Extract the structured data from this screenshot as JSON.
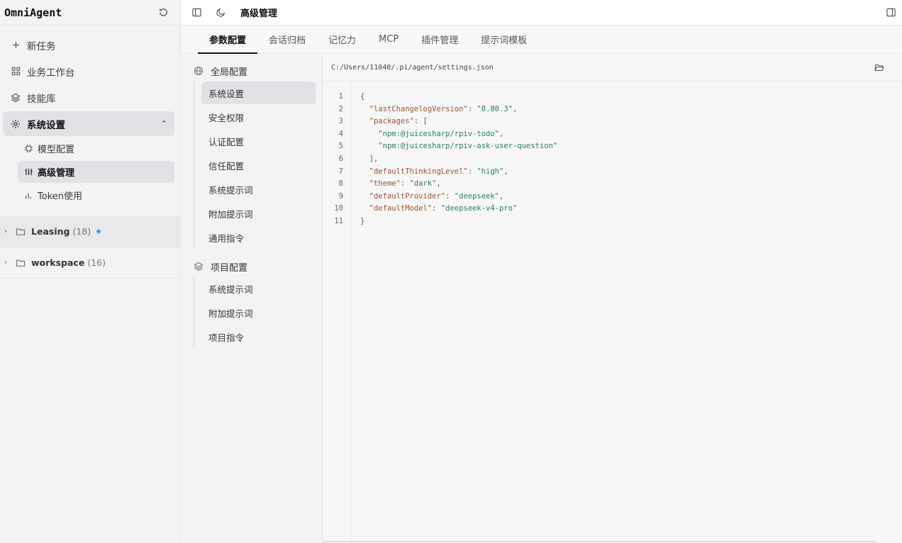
{
  "app": {
    "title": "OmniAgent"
  },
  "sidebar": {
    "items": [
      {
        "label": "新任务",
        "icon": "plus-icon"
      },
      {
        "label": "业务工作台",
        "icon": "grid-icon"
      },
      {
        "label": "技能库",
        "icon": "layers-icon"
      },
      {
        "label": "系统设置",
        "icon": "gear-icon"
      }
    ],
    "sub_items": [
      {
        "label": "模型配置",
        "icon": "chip-icon"
      },
      {
        "label": "高级管理",
        "icon": "sliders-icon"
      },
      {
        "label": "Token使用",
        "icon": "bar-chart-icon"
      }
    ],
    "folders": [
      {
        "name": "Leasing",
        "count": "(18)",
        "star": "★"
      },
      {
        "name": "workspace",
        "count": "(16)"
      }
    ]
  },
  "topbar": {
    "title": "高级管理"
  },
  "tabs": [
    {
      "label": "参数配置"
    },
    {
      "label": "会话归档"
    },
    {
      "label": "记忆力"
    },
    {
      "label": "MCP"
    },
    {
      "label": "插件管理"
    },
    {
      "label": "提示词模板"
    }
  ],
  "config_tree": {
    "global": {
      "label": "全局配置",
      "items": [
        "系统设置",
        "安全权限",
        "认证配置",
        "信任配置",
        "系统提示词",
        "附加提示词",
        "通用指令"
      ]
    },
    "project": {
      "label": "项目配置",
      "items": [
        "系统提示词",
        "附加提示词",
        "项目指令"
      ]
    }
  },
  "editor": {
    "file_path": "C:/Users/11040/.pi/agent/settings.json",
    "line_numbers": [
      "1",
      "2",
      "3",
      "4",
      "5",
      "6",
      "7",
      "8",
      "9",
      "10",
      "11"
    ],
    "lines": [
      {
        "indent": "",
        "key": "",
        "value": "",
        "punct": "{"
      },
      {
        "indent": "  ",
        "key": "\"lastChangelogVersion\"",
        "sep": ": ",
        "value": "\"0.80.3\"",
        "punct": ","
      },
      {
        "indent": "  ",
        "key": "\"packages\"",
        "sep": ": ",
        "value": "",
        "punct": "["
      },
      {
        "indent": "    ",
        "key": "",
        "value": "\"npm:@juicesharp/rpiv-todo\"",
        "punct": ","
      },
      {
        "indent": "    ",
        "key": "",
        "value": "\"npm:@juicesharp/rpiv-ask-user-question\"",
        "punct": ""
      },
      {
        "indent": "  ",
        "key": "",
        "value": "",
        "punct": "],"
      },
      {
        "indent": "  ",
        "key": "\"defaultThinkingLevel\"",
        "sep": ": ",
        "value": "\"high\"",
        "punct": ","
      },
      {
        "indent": "  ",
        "key": "\"theme\"",
        "sep": ": ",
        "value": "\"dark\"",
        "punct": ","
      },
      {
        "indent": "  ",
        "key": "\"defaultProvider\"",
        "sep": ": ",
        "value": "\"deepseek\"",
        "punct": ","
      },
      {
        "indent": "  ",
        "key": "\"defaultModel\"",
        "sep": ": ",
        "value": "\"deepseek-v4-pro\"",
        "punct": ""
      },
      {
        "indent": "",
        "key": "",
        "value": "",
        "punct": "}"
      }
    ]
  },
  "colors": {
    "accent_star": "#3b82f6",
    "json_key": "#a0522d",
    "json_string": "#2e7d5b"
  }
}
